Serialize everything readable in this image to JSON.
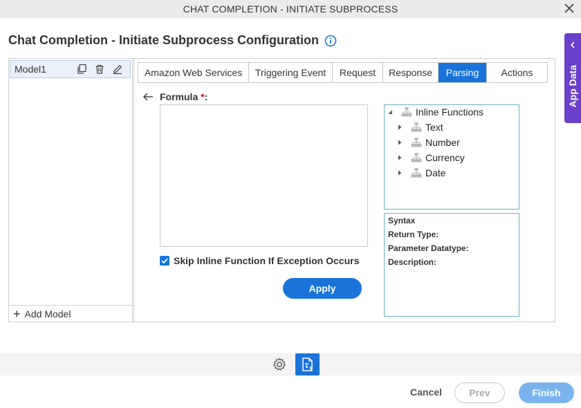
{
  "window": {
    "title": "CHAT COMPLETION - INITIATE SUBPROCESS"
  },
  "page": {
    "heading": "Chat Completion - Initiate Subprocess Configuration"
  },
  "side_panel": {
    "label": "App Data"
  },
  "models": {
    "items": [
      {
        "name": "Model1"
      }
    ],
    "add_label": "Add Model"
  },
  "tabs": [
    {
      "label": "Amazon Web Services",
      "active": false
    },
    {
      "label": "Triggering Event",
      "active": false
    },
    {
      "label": "Request",
      "active": false
    },
    {
      "label": "Response",
      "active": false
    },
    {
      "label": "Parsing",
      "active": true
    },
    {
      "label": "Actions",
      "active": false
    }
  ],
  "formula": {
    "label": "Formula",
    "required_mark": "*",
    "suffix": ":",
    "value": ""
  },
  "skip": {
    "label": "Skip Inline Function If Exception Occurs",
    "checked": true
  },
  "apply_label": "Apply",
  "tree": {
    "root": "Inline Functions",
    "children": [
      "Text",
      "Number",
      "Currency",
      "Date"
    ]
  },
  "syntax": {
    "title": "Syntax",
    "return_type": "Return Type:",
    "parameter_datatype": "Parameter Datatype:",
    "description": "Description:"
  },
  "footer": {
    "cancel": "Cancel",
    "prev": "Prev",
    "finish": "Finish"
  },
  "colors": {
    "primary": "#1a73d9",
    "app_data": "#6a3fc9",
    "tree_border": "#6bb2b8",
    "finish_disabled": "#7ab4ee"
  }
}
